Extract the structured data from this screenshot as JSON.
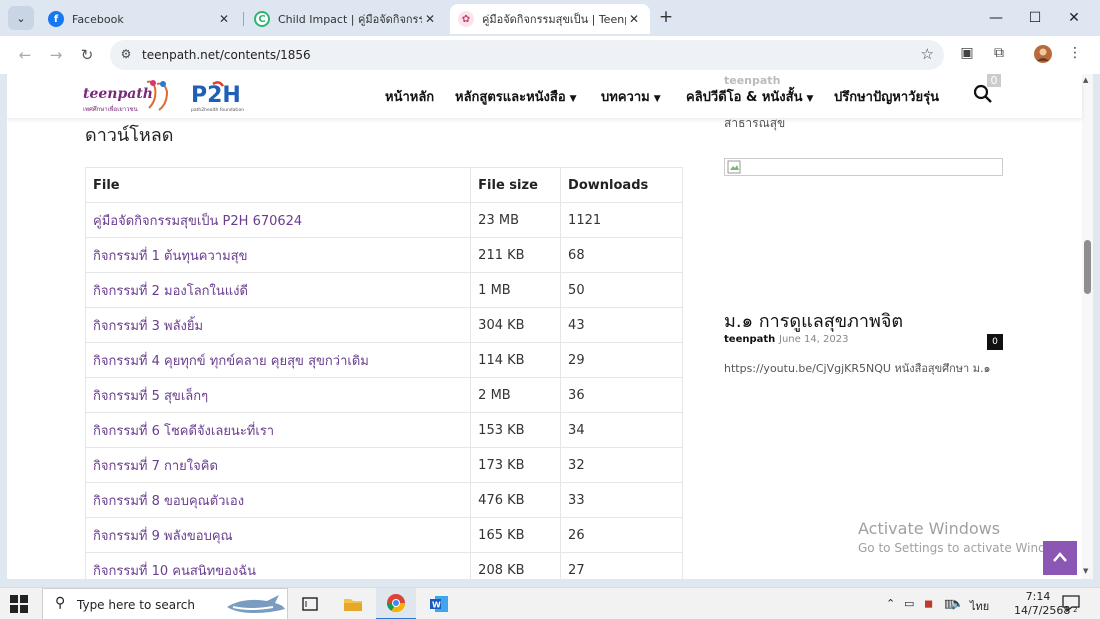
{
  "browser": {
    "tabs": [
      {
        "title": "Facebook",
        "favicon": "facebook-icon"
      },
      {
        "title": "Child Impact | คู่มือจัดกิจกรรม \"สุข",
        "favicon": "childimpact-icon"
      },
      {
        "title": "คู่มือจัดกิจกรรมสุขเป็น | Teenpath.n",
        "favicon": "teenpath-icon"
      }
    ],
    "url": "teenpath.net/contents/1856"
  },
  "site": {
    "logo_text": "teenpath",
    "logo_sub": "เพศศึกษาเพื่อเยาวชน",
    "p2h_text": "P2H",
    "p2h_sub": "path2health foundation",
    "menu": [
      {
        "label": "หน้าหลัก"
      },
      {
        "label": "หลักสูตรและหนังสือ"
      },
      {
        "label": "บทความ"
      },
      {
        "label": "คลิปวีดีโอ & หนังสั้น"
      },
      {
        "label": "ปรึกษาปัญหาวัยรุ่น"
      }
    ]
  },
  "behind_header": {
    "author": "teenpath",
    "count": "0"
  },
  "downloads": {
    "title": "ดาวน์โหลด",
    "headers": {
      "file": "File",
      "size": "File size",
      "downloads": "Downloads"
    },
    "rows": [
      {
        "file": "คู่มือจัดกิจกรรมสุขเป็น P2H 670624",
        "size": "23 MB",
        "downloads": "1121"
      },
      {
        "file": "กิจกรรมที่ 1 ต้นทุนความสุข",
        "size": "211 KB",
        "downloads": "68"
      },
      {
        "file": "กิจกรรมที่ 2 มองโลกในแง่ดี",
        "size": "1 MB",
        "downloads": "50"
      },
      {
        "file": "กิจกรรมที่ 3 พลังยิ้ม",
        "size": "304 KB",
        "downloads": "43"
      },
      {
        "file": "กิจกรรมที่ 4 คุยทุกข์ ทุกข์คลาย คุยสุข สุขกว่าเดิม",
        "size": "114 KB",
        "downloads": "29"
      },
      {
        "file": "กิจกรรมที่ 5 สุขเล็กๆ",
        "size": "2 MB",
        "downloads": "36"
      },
      {
        "file": "กิจกรรมที่ 6 โชคดีจังเลยนะที่เรา",
        "size": "153 KB",
        "downloads": "34"
      },
      {
        "file": "กิจกรรมที่ 7 กายใจคิด",
        "size": "173 KB",
        "downloads": "32"
      },
      {
        "file": "กิจกรรมที่ 8 ขอบคุณตัวเอง",
        "size": "476 KB",
        "downloads": "33"
      },
      {
        "file": "กิจกรรมที่ 9 พลังขอบคุณ",
        "size": "165 KB",
        "downloads": "26"
      },
      {
        "file": "กิจกรรมที่ 10 คนสนิทของฉัน",
        "size": "208 KB",
        "downloads": "27"
      }
    ]
  },
  "sidebar": {
    "top_text": "สาธารณสุข",
    "post_title": "ม.๑ การดูแลสุขภาพจิต",
    "post_author": "teenpath",
    "post_date": "June 14, 2023",
    "post_comments": "0",
    "post_desc": "https://youtu.be/CjVgjKR5NQU หนังสือสุขศึกษา ม.๑"
  },
  "watermark": {
    "line1": "Activate Windows",
    "line2": "Go to Settings to activate Windows."
  },
  "taskbar": {
    "search_placeholder": "Type here to search",
    "language": "ไทย",
    "time": "7:14",
    "date": "14/7/2568",
    "notification_count": "2"
  },
  "colors": {
    "link": "#6a3d8f",
    "accent": "#8b56b4",
    "chrome_active_tab": "#ffffff",
    "tabstrip": "#dde6f1"
  }
}
